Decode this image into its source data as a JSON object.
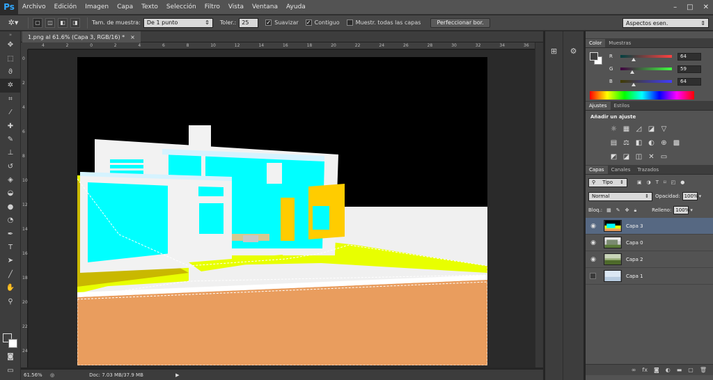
{
  "app": {
    "logo": "Ps"
  },
  "menu": [
    "Archivo",
    "Edición",
    "Imagen",
    "Capa",
    "Texto",
    "Selección",
    "Filtro",
    "Vista",
    "Ventana",
    "Ayuda"
  ],
  "window_controls": [
    "–",
    "□",
    "✕"
  ],
  "options": {
    "sample_size_label": "Tam. de muestra:",
    "sample_size_value": "De 1 punto",
    "tolerance_label": "Toler.:",
    "tolerance_value": "25",
    "antialias_label": "Suavizar",
    "contiguous_label": "Contiguo",
    "sample_all_label": "Muestr. todas las capas",
    "refine_edge_label": "Perfeccionar bor.",
    "workspace_value": "Aspectos esen."
  },
  "document": {
    "tab_title": "1.png al 61.6% (Capa 3, RGB/16) *",
    "zoom": "61.56%",
    "doc_info": "Doc: 7.03 MB/37.9 MB",
    "ruler_h": [
      "4",
      "2",
      "0",
      "2",
      "4",
      "6",
      "8",
      "10",
      "12",
      "14",
      "16",
      "18",
      "20",
      "22",
      "24",
      "26",
      "28",
      "30",
      "32",
      "34",
      "36"
    ],
    "ruler_v": [
      "0",
      "2",
      "4",
      "6",
      "8",
      "10",
      "12",
      "14",
      "16",
      "18",
      "20",
      "22",
      "24"
    ]
  },
  "color_panel": {
    "tabs": [
      "Color",
      "Muestras"
    ],
    "channels": [
      {
        "label": "R",
        "value": "64",
        "fraction": 0.25,
        "gradient": "linear-gradient(to right,#004040,#ff4040)"
      },
      {
        "label": "G",
        "value": "59",
        "fraction": 0.23,
        "gradient": "linear-gradient(to right,#400040,#40ff40)"
      },
      {
        "label": "B",
        "value": "64",
        "fraction": 0.25,
        "gradient": "linear-gradient(to right,#403b00,#403bff)"
      }
    ]
  },
  "adjustments_panel": {
    "tabs": [
      "Ajustes",
      "Estilos"
    ],
    "title": "Añadir un ajuste"
  },
  "layers_panel": {
    "tabs": [
      "Capas",
      "Canales",
      "Trazados"
    ],
    "filter_value": "Tipo",
    "blend_mode": "Normal",
    "opacity_label": "Opacidad:",
    "opacity_value": "100%",
    "lock_label": "Bloq.:",
    "fill_label": "Relleno:",
    "fill_value": "100%",
    "layers": [
      {
        "name": "Capa 3",
        "visible": true,
        "selected": true
      },
      {
        "name": "Capa 0",
        "visible": true,
        "selected": false
      },
      {
        "name": "Capa 2",
        "visible": true,
        "selected": false
      },
      {
        "name": "Capa 1",
        "visible": false,
        "selected": false
      }
    ]
  },
  "colors": {
    "accent": "#31a8ff",
    "selected_layer": "#566882",
    "cyan": "#00ffff",
    "yellow": "#e8ff00",
    "orange": "#e99d5e",
    "gold": "#ffcc00"
  }
}
